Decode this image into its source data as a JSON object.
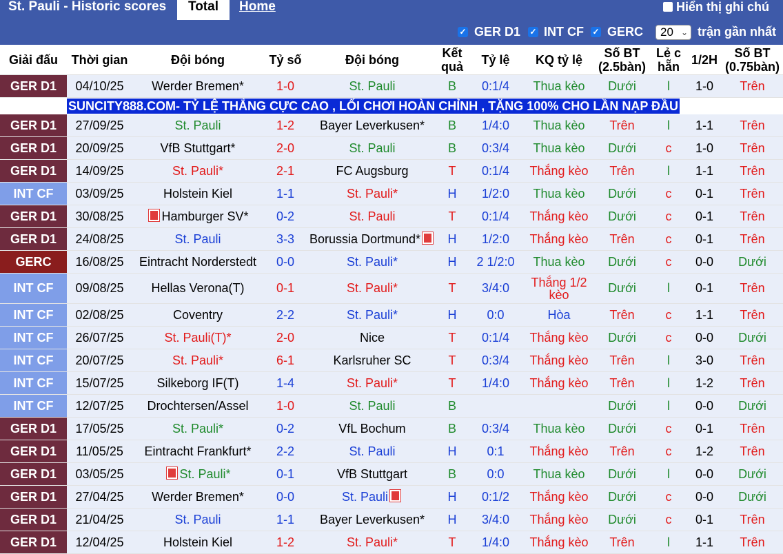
{
  "header": {
    "title": "St. Pauli - Historic scores",
    "tab_total": "Total",
    "tab_home": "Home",
    "show_label": "Hiển thị ghi chú"
  },
  "filters": {
    "items": [
      {
        "label": "GER D1",
        "checked": true
      },
      {
        "label": "INT CF",
        "checked": true
      },
      {
        "label": "GERC",
        "checked": true
      }
    ],
    "count_value": "20",
    "count_suffix": "trận gần nhất"
  },
  "columns": [
    "Giải đấu",
    "Thời gian",
    "Đội bóng",
    "Tỷ số",
    "Đội bóng",
    "Kết quả",
    "Tỷ lệ",
    "KQ tỷ lệ",
    "Số BT (2.5bàn)",
    "Lẻ c hẵn",
    "1/2H",
    "Số BT (0.75bàn)"
  ],
  "ad_text": "SUNCITY888.COM- TỶ LỆ THẮNG CỰC CAO , LỐI CHƠI HOÀN CHỈNH , TẶNG 100% CHO LẦN NẠP ĐẦU",
  "league_colors": {
    "GER D1": "#6e2b3e",
    "INT CF": "#7f9ee8",
    "GERC": "#8a1d1d"
  },
  "rows": [
    {
      "league": "GER D1",
      "date": "04/10/25",
      "home": "Werder Bremen",
      "home_mark": "*",
      "home_flag": false,
      "home_color": "dark",
      "score": "1-0",
      "score_color": "red",
      "away": "St. Pauli",
      "away_mark": "",
      "away_flag": false,
      "away_color": "green",
      "result": "B",
      "odds": "0:1/4",
      "odds_result": "Thua kèo",
      "ou": "Dưới",
      "oe": "l",
      "half": "1-0",
      "ou2": "Trên"
    },
    {
      "league": "GER D1",
      "date": "27/09/25",
      "home": "St. Pauli",
      "home_mark": "",
      "home_flag": false,
      "home_color": "green",
      "score": "1-2",
      "score_color": "red",
      "away": "Bayer Leverkusen",
      "away_mark": "*",
      "away_flag": false,
      "away_color": "dark",
      "result": "B",
      "odds": "1/4:0",
      "odds_result": "Thua kèo",
      "ou": "Trên",
      "oe": "l",
      "half": "1-1",
      "ou2": "Trên"
    },
    {
      "league": "GER D1",
      "date": "20/09/25",
      "home": "VfB Stuttgart",
      "home_mark": "*",
      "home_flag": false,
      "home_color": "dark",
      "score": "2-0",
      "score_color": "red",
      "away": "St. Pauli",
      "away_mark": "",
      "away_flag": false,
      "away_color": "green",
      "result": "B",
      "odds": "0:3/4",
      "odds_result": "Thua kèo",
      "ou": "Dưới",
      "oe": "c",
      "half": "1-0",
      "ou2": "Trên"
    },
    {
      "league": "GER D1",
      "date": "14/09/25",
      "home": "St. Pauli",
      "home_mark": "*",
      "home_flag": false,
      "home_color": "red",
      "score": "2-1",
      "score_color": "red",
      "away": "FC Augsburg",
      "away_mark": "",
      "away_flag": false,
      "away_color": "dark",
      "result": "T",
      "odds": "0:1/4",
      "odds_result": "Thắng kèo",
      "ou": "Trên",
      "oe": "l",
      "half": "1-1",
      "ou2": "Trên"
    },
    {
      "league": "INT CF",
      "date": "03/09/25",
      "home": "Holstein Kiel",
      "home_mark": "",
      "home_flag": false,
      "home_color": "dark",
      "score": "1-1",
      "score_color": "blue",
      "away": "St. Pauli",
      "away_mark": "*",
      "away_flag": false,
      "away_color": "red",
      "result": "H",
      "odds": "1/2:0",
      "odds_result": "Thua kèo",
      "ou": "Dưới",
      "oe": "c",
      "half": "0-1",
      "ou2": "Trên"
    },
    {
      "league": "GER D1",
      "date": "30/08/25",
      "home": "Hamburger SV",
      "home_mark": "*",
      "home_flag": true,
      "home_color": "dark",
      "score": "0-2",
      "score_color": "blue",
      "away": "St. Pauli",
      "away_mark": "",
      "away_flag": false,
      "away_color": "red",
      "result": "T",
      "odds": "0:1/4",
      "odds_result": "Thắng kèo",
      "ou": "Dưới",
      "oe": "c",
      "half": "0-1",
      "ou2": "Trên"
    },
    {
      "league": "GER D1",
      "date": "24/08/25",
      "home": "St. Pauli",
      "home_mark": "",
      "home_flag": false,
      "home_color": "blue",
      "score": "3-3",
      "score_color": "blue",
      "away": "Borussia Dortmund",
      "away_mark": "*",
      "away_flag": true,
      "away_color": "dark",
      "result": "H",
      "odds": "1/2:0",
      "odds_result": "Thắng kèo",
      "ou": "Trên",
      "oe": "c",
      "half": "0-1",
      "ou2": "Trên"
    },
    {
      "league": "GERC",
      "date": "16/08/25",
      "home": "Eintracht Norderstedt",
      "home_mark": "",
      "home_flag": false,
      "home_color": "dark",
      "score": "0-0",
      "score_color": "blue",
      "away": "St. Pauli",
      "away_mark": "*",
      "away_flag": false,
      "away_color": "blue",
      "result": "H",
      "odds": "2 1/2:0",
      "odds_result": "Thua kèo",
      "ou": "Dưới",
      "oe": "c",
      "half": "0-0",
      "ou2": "Dưới"
    },
    {
      "league": "INT CF",
      "date": "09/08/25",
      "home": "Hellas Verona(T)",
      "home_mark": "",
      "home_flag": false,
      "home_color": "dark",
      "score": "0-1",
      "score_color": "red",
      "away": "St. Pauli",
      "away_mark": "*",
      "away_flag": false,
      "away_color": "red",
      "result": "T",
      "odds": "3/4:0",
      "odds_result": "Thắng 1/2 kèo",
      "ou": "Dưới",
      "oe": "l",
      "half": "0-1",
      "ou2": "Trên",
      "tall": true
    },
    {
      "league": "INT CF",
      "date": "02/08/25",
      "home": "Coventry",
      "home_mark": "",
      "home_flag": false,
      "home_color": "dark",
      "score": "2-2",
      "score_color": "blue",
      "away": "St. Pauli",
      "away_mark": "*",
      "away_flag": false,
      "away_color": "blue",
      "result": "H",
      "odds": "0:0",
      "odds_result": "Hòa",
      "ou": "Trên",
      "oe": "c",
      "half": "1-1",
      "ou2": "Trên"
    },
    {
      "league": "INT CF",
      "date": "26/07/25",
      "home": "St. Pauli(T)",
      "home_mark": "*",
      "home_flag": false,
      "home_color": "red",
      "score": "2-0",
      "score_color": "red",
      "away": "Nice",
      "away_mark": "",
      "away_flag": false,
      "away_color": "dark",
      "result": "T",
      "odds": "0:1/4",
      "odds_result": "Thắng kèo",
      "ou": "Dưới",
      "oe": "c",
      "half": "0-0",
      "ou2": "Dưới"
    },
    {
      "league": "INT CF",
      "date": "20/07/25",
      "home": "St. Pauli",
      "home_mark": "*",
      "home_flag": false,
      "home_color": "red",
      "score": "6-1",
      "score_color": "red",
      "away": "Karlsruher SC",
      "away_mark": "",
      "away_flag": false,
      "away_color": "dark",
      "result": "T",
      "odds": "0:3/4",
      "odds_result": "Thắng kèo",
      "ou": "Trên",
      "oe": "l",
      "half": "3-0",
      "ou2": "Trên"
    },
    {
      "league": "INT CF",
      "date": "15/07/25",
      "home": "Silkeborg IF(T)",
      "home_mark": "",
      "home_flag": false,
      "home_color": "dark",
      "score": "1-4",
      "score_color": "blue",
      "away": "St. Pauli",
      "away_mark": "*",
      "away_flag": false,
      "away_color": "red",
      "result": "T",
      "odds": "1/4:0",
      "odds_result": "Thắng kèo",
      "ou": "Trên",
      "oe": "l",
      "half": "1-2",
      "ou2": "Trên"
    },
    {
      "league": "INT CF",
      "date": "12/07/25",
      "home": "Drochtersen/Assel",
      "home_mark": "",
      "home_flag": false,
      "home_color": "dark",
      "score": "1-0",
      "score_color": "red",
      "away": "St. Pauli",
      "away_mark": "",
      "away_flag": false,
      "away_color": "green",
      "result": "B",
      "odds": "",
      "odds_result": "",
      "ou": "Dưới",
      "oe": "l",
      "half": "0-0",
      "ou2": "Dưới"
    },
    {
      "league": "GER D1",
      "date": "17/05/25",
      "home": "St. Pauli",
      "home_mark": "*",
      "home_flag": false,
      "home_color": "green",
      "score": "0-2",
      "score_color": "blue",
      "away": "VfL Bochum",
      "away_mark": "",
      "away_flag": false,
      "away_color": "dark",
      "result": "B",
      "odds": "0:3/4",
      "odds_result": "Thua kèo",
      "ou": "Dưới",
      "oe": "c",
      "half": "0-1",
      "ou2": "Trên"
    },
    {
      "league": "GER D1",
      "date": "11/05/25",
      "home": "Eintracht Frankfurt",
      "home_mark": "*",
      "home_flag": false,
      "home_color": "dark",
      "score": "2-2",
      "score_color": "blue",
      "away": "St. Pauli",
      "away_mark": "",
      "away_flag": false,
      "away_color": "blue",
      "result": "H",
      "odds": "0:1",
      "odds_result": "Thắng kèo",
      "ou": "Trên",
      "oe": "c",
      "half": "1-2",
      "ou2": "Trên"
    },
    {
      "league": "GER D1",
      "date": "03/05/25",
      "home": "St. Pauli",
      "home_mark": "*",
      "home_flag": true,
      "home_color": "green",
      "score": "0-1",
      "score_color": "blue",
      "away": "VfB Stuttgart",
      "away_mark": "",
      "away_flag": false,
      "away_color": "dark",
      "result": "B",
      "odds": "0:0",
      "odds_result": "Thua kèo",
      "ou": "Dưới",
      "oe": "l",
      "half": "0-0",
      "ou2": "Dưới"
    },
    {
      "league": "GER D1",
      "date": "27/04/25",
      "home": "Werder Bremen",
      "home_mark": "*",
      "home_flag": false,
      "home_color": "dark",
      "score": "0-0",
      "score_color": "blue",
      "away": "St. Pauli",
      "away_mark": "",
      "away_flag": true,
      "away_color": "blue",
      "result": "H",
      "odds": "0:1/2",
      "odds_result": "Thắng kèo",
      "ou": "Dưới",
      "oe": "c",
      "half": "0-0",
      "ou2": "Dưới"
    },
    {
      "league": "GER D1",
      "date": "21/04/25",
      "home": "St. Pauli",
      "home_mark": "",
      "home_flag": false,
      "home_color": "blue",
      "score": "1-1",
      "score_color": "blue",
      "away": "Bayer Leverkusen",
      "away_mark": "*",
      "away_flag": false,
      "away_color": "dark",
      "result": "H",
      "odds": "3/4:0",
      "odds_result": "Thắng kèo",
      "ou": "Dưới",
      "oe": "c",
      "half": "0-1",
      "ou2": "Trên"
    },
    {
      "league": "GER D1",
      "date": "12/04/25",
      "home": "Holstein Kiel",
      "home_mark": "",
      "home_flag": false,
      "home_color": "dark",
      "score": "1-2",
      "score_color": "red",
      "away": "St. Pauli",
      "away_mark": "*",
      "away_flag": false,
      "away_color": "red",
      "result": "T",
      "odds": "1/4:0",
      "odds_result": "Thắng kèo",
      "ou": "Trên",
      "oe": "l",
      "half": "1-1",
      "ou2": "Trên"
    }
  ]
}
